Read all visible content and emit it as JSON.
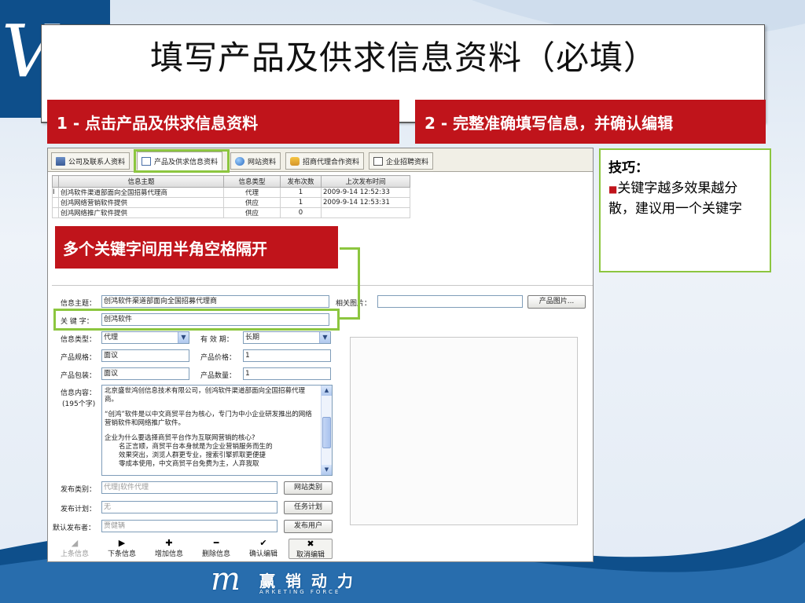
{
  "slide": {
    "title": "填写产品及供求信息资料（必填）",
    "step1": "1 - 点击产品及供求信息资料",
    "step2": "2 - 完整准确填写信息，并确认编辑",
    "note": "多个关键字间用半角空格隔开",
    "tip_title": "技巧：",
    "tip_bullet": "■",
    "tip_text": "关键字越多效果越分散，建议用一个关键字",
    "logo_cn": "赢 销 动 力",
    "logo_en": "ARKETING FORCE"
  },
  "colors": {
    "banner_red": "#c0141b",
    "highlight_green": "#8cc63f",
    "logo_blue": "#0e4f8b"
  },
  "tabs": [
    {
      "label": "公司及联系人资料",
      "icon": "card-icon"
    },
    {
      "label": "产品及供求信息资料",
      "icon": "document-icon",
      "active": true
    },
    {
      "label": "网站资料",
      "icon": "globe-icon"
    },
    {
      "label": "招商代理合作资料",
      "icon": "handshake-icon"
    },
    {
      "label": "企业招聘资料",
      "icon": "person-icon"
    }
  ],
  "grid": {
    "headers": [
      "信息主题",
      "信息类型",
      "发布次数",
      "上次发布时间"
    ],
    "rows": [
      [
        "创鸿软件渠道部面向全国招募代理商",
        "代理",
        "1",
        "2009-9-14 12:52:33"
      ],
      [
        "创鸿网络营销软件提供",
        "供应",
        "1",
        "2009-9-14 12:53:31"
      ],
      [
        "创鸿网络推广软件提供",
        "供应",
        "0",
        ""
      ]
    ]
  },
  "form": {
    "subject_label": "信息主题：",
    "subject_value": "创鸿软件渠道部面向全国招募代理商",
    "image_label": "相关图片：",
    "image_value": "",
    "image_button": "产品图片...",
    "keyword_label": "关 键 字：",
    "keyword_value": "创鸿软件",
    "type_label": "信息类型：",
    "type_value": "代理",
    "validity_label": "有 效 期：",
    "validity_value": "长期",
    "spec_label": "产品规格：",
    "spec_value": "面议",
    "price_label": "产品价格：",
    "price_value": "1",
    "package_label": "产品包装：",
    "package_value": "面议",
    "qty_label": "产品数量：",
    "qty_value": "1",
    "content_label": "信息内容：",
    "content_count": "(195个字)",
    "content_p1": "北京盛世鸿创信息技术有限公司，创鸿软件渠道部面向全国招募代理商。",
    "content_p2": "“创鸿”软件是以中文商贸平台为核心，专门为中小企业研发推出的网络营销软件和网络推广软件。",
    "content_p3": "企业为什么要选择商贸平台作为互联网营销的核心?",
    "content_p4": "名正言顺，商贸平台本身就是为企业营销服务而生的",
    "content_p5": "效果突出，浏览人群更专业，搜索引擎抓取更便捷",
    "content_p6": "零成本使用，中文商贸平台免费为主，人弃我取",
    "category_label": "发布类别：",
    "category_value": "代理|软件代理",
    "category_button": "网站类别",
    "plan_label": "发布计划：",
    "plan_value": "无",
    "plan_button": "任务计划",
    "publisher_label": "默认发布者：",
    "publisher_value": "贾健辆",
    "publisher_button": "发布用户"
  },
  "toolbar": {
    "prev": {
      "label": "上条信息",
      "symbol": "◢"
    },
    "next": {
      "label": "下条信息",
      "symbol": "▶"
    },
    "add": {
      "label": "增加信息",
      "symbol": "✚"
    },
    "delete": {
      "label": "删除信息",
      "symbol": "━"
    },
    "confirm": {
      "label": "确认编辑",
      "symbol": "✔"
    },
    "cancel": {
      "label": "取消编辑",
      "symbol": "✖"
    }
  }
}
